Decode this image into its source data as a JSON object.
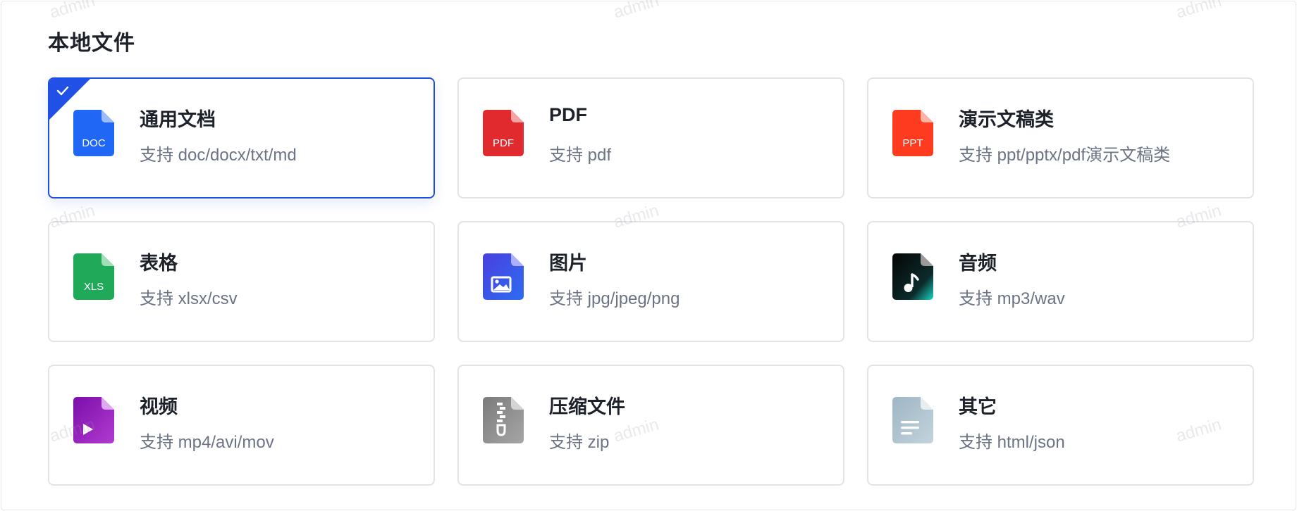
{
  "section": {
    "title": "本地文件"
  },
  "cards": [
    {
      "name": "通用文档",
      "desc": "支持 doc/docx/txt/md",
      "badge": "DOC",
      "icon": "doc-file-icon",
      "color": "#2167f5",
      "selected": true
    },
    {
      "name": "PDF",
      "desc": "支持 pdf",
      "badge": "PDF",
      "icon": "pdf-file-icon",
      "color": "#e02a2e",
      "selected": false
    },
    {
      "name": "演示文稿类",
      "desc": "支持 ppt/pptx/pdf演示文稿类",
      "badge": "PPT",
      "icon": "ppt-file-icon",
      "color": "#ff3b1f",
      "selected": false
    },
    {
      "name": "表格",
      "desc": "支持 xlsx/csv",
      "badge": "XLS",
      "icon": "xls-file-icon",
      "color": "#21a95a",
      "selected": false
    },
    {
      "name": "图片",
      "desc": "支持 jpg/jpeg/png",
      "badge": "",
      "icon": "image-file-icon",
      "color": "#3d3fe0",
      "selected": false
    },
    {
      "name": "音频",
      "desc": "支持 mp3/wav",
      "badge": "",
      "icon": "audio-file-icon",
      "color": "#0a0a0a",
      "selected": false
    },
    {
      "name": "视频",
      "desc": "支持 mp4/avi/mov",
      "badge": "",
      "icon": "video-file-icon",
      "color": "#8e1bb8",
      "selected": false
    },
    {
      "name": "压缩文件",
      "desc": "支持 zip",
      "badge": "",
      "icon": "zip-file-icon",
      "color": "#8a8a8a",
      "selected": false
    },
    {
      "name": "其它",
      "desc": "支持 html/json",
      "badge": "",
      "icon": "other-file-icon",
      "color": "#a9bfcc",
      "selected": false
    }
  ],
  "watermark": {
    "text": "admin"
  }
}
